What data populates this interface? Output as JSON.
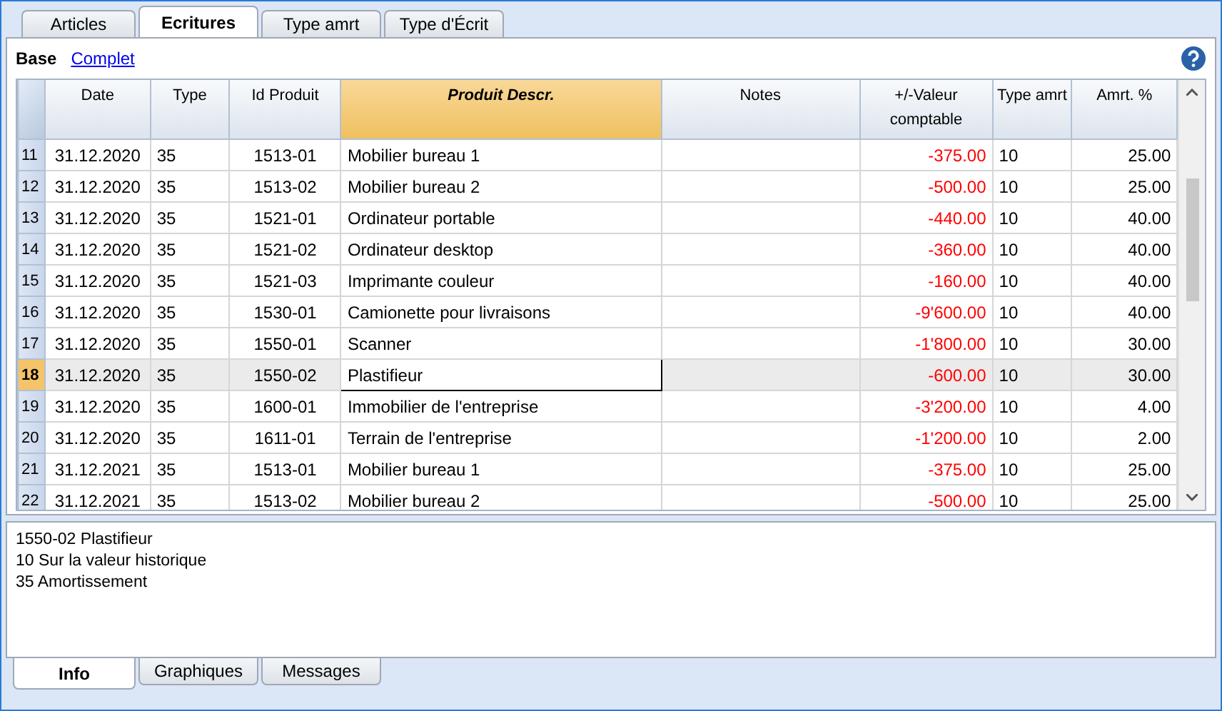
{
  "tabs": [
    {
      "label": "Articles",
      "selected": false
    },
    {
      "label": "Ecritures",
      "selected": true
    },
    {
      "label": "Type amrt",
      "selected": false
    },
    {
      "label": "Type d'Écrit",
      "selected": false
    }
  ],
  "views": [
    {
      "label": "Base",
      "selected": true
    },
    {
      "label": "Complet",
      "selected": false
    }
  ],
  "table": {
    "columns": [
      {
        "label": "Date",
        "selected": false
      },
      {
        "label": "Type",
        "selected": false
      },
      {
        "label": "Id Produit",
        "selected": false
      },
      {
        "label": "Produit Descr.",
        "selected": true
      },
      {
        "label": "Notes",
        "selected": false
      },
      {
        "label": "+/-Valeur comptable",
        "selected": false
      },
      {
        "label": "Type amrt",
        "selected": false
      },
      {
        "label": "Amrt. %",
        "selected": false
      }
    ],
    "rows": [
      {
        "number": "11",
        "selected": false,
        "cells": [
          "31.12.2020",
          "35",
          "1513-01",
          "Mobilier bureau 1",
          "",
          "-375.00",
          "10",
          "25.00"
        ]
      },
      {
        "number": "12",
        "selected": false,
        "cells": [
          "31.12.2020",
          "35",
          "1513-02",
          "Mobilier bureau 2",
          "",
          "-500.00",
          "10",
          "25.00"
        ]
      },
      {
        "number": "13",
        "selected": false,
        "cells": [
          "31.12.2020",
          "35",
          "1521-01",
          "Ordinateur portable",
          "",
          "-440.00",
          "10",
          "40.00"
        ]
      },
      {
        "number": "14",
        "selected": false,
        "cells": [
          "31.12.2020",
          "35",
          "1521-02",
          "Ordinateur desktop",
          "",
          "-360.00",
          "10",
          "40.00"
        ]
      },
      {
        "number": "15",
        "selected": false,
        "cells": [
          "31.12.2020",
          "35",
          "1521-03",
          "Imprimante couleur",
          "",
          "-160.00",
          "10",
          "40.00"
        ]
      },
      {
        "number": "16",
        "selected": false,
        "cells": [
          "31.12.2020",
          "35",
          "1530-01",
          "Camionette pour livraisons",
          "",
          "-9'600.00",
          "10",
          "40.00"
        ]
      },
      {
        "number": "17",
        "selected": false,
        "cells": [
          "31.12.2020",
          "35",
          "1550-01",
          "Scanner",
          "",
          "-1'800.00",
          "10",
          "30.00"
        ]
      },
      {
        "number": "18",
        "selected": true,
        "cells": [
          "31.12.2020",
          "35",
          "1550-02",
          "Plastifieur",
          "",
          "-600.00",
          "10",
          "30.00"
        ]
      },
      {
        "number": "19",
        "selected": false,
        "cells": [
          "31.12.2020",
          "35",
          "1600-01",
          "Immobilier de l'entreprise",
          "",
          "-3'200.00",
          "10",
          "4.00"
        ]
      },
      {
        "number": "20",
        "selected": false,
        "cells": [
          "31.12.2020",
          "35",
          "1611-01",
          "Terrain de l'entreprise",
          "",
          "-1'200.00",
          "10",
          "2.00"
        ]
      },
      {
        "number": "21",
        "selected": false,
        "cells": [
          "31.12.2021",
          "35",
          "1513-01",
          "Mobilier bureau 1",
          "",
          "-375.00",
          "10",
          "25.00"
        ]
      },
      {
        "number": "22",
        "selected": false,
        "cells": [
          "31.12.2021",
          "35",
          "1513-02",
          "Mobilier bureau 2",
          "",
          "-500.00",
          "10",
          "25.00"
        ]
      }
    ]
  },
  "info": [
    "1550-02 Plastifieur",
    "10 Sur la valeur historique",
    "35 Amortissement"
  ],
  "bottom_tabs": [
    {
      "label": "Info",
      "selected": true
    },
    {
      "label": "Graphiques",
      "selected": false
    },
    {
      "label": "Messages",
      "selected": false
    }
  ]
}
